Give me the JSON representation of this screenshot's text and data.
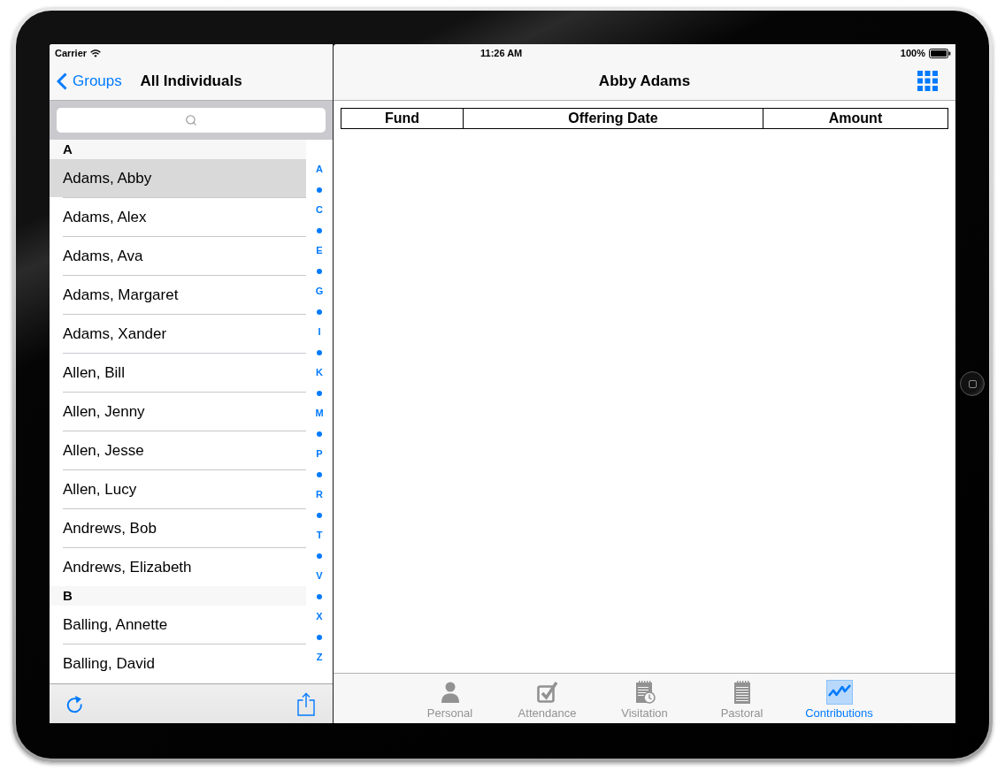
{
  "left_panel": {
    "status_bar": {
      "carrier": "Carrier"
    },
    "nav_bar": {
      "back": "Groups",
      "title": "All Individuals"
    },
    "sections": [
      {
        "header": "A",
        "rows": [
          {
            "name": "Adams, Abby",
            "selected": true
          },
          {
            "name": "Adams, Alex",
            "selected": false
          },
          {
            "name": "Adams, Ava",
            "selected": false
          },
          {
            "name": "Adams, Margaret",
            "selected": false
          },
          {
            "name": "Adams, Xander",
            "selected": false
          },
          {
            "name": "Allen, Bill",
            "selected": false
          },
          {
            "name": "Allen, Jenny",
            "selected": false
          },
          {
            "name": "Allen, Jesse",
            "selected": false
          },
          {
            "name": "Allen, Lucy",
            "selected": false
          },
          {
            "name": "Andrews, Bob",
            "selected": false
          },
          {
            "name": "Andrews, Elizabeth",
            "selected": false
          }
        ]
      },
      {
        "header": "B",
        "rows": [
          {
            "name": "Balling, Annette",
            "selected": false
          },
          {
            "name": "Balling, David",
            "selected": false
          }
        ]
      }
    ],
    "index": [
      {
        "kind": "letter",
        "label": "A"
      },
      {
        "kind": "dot"
      },
      {
        "kind": "letter",
        "label": "C"
      },
      {
        "kind": "dot"
      },
      {
        "kind": "letter",
        "label": "E"
      },
      {
        "kind": "dot"
      },
      {
        "kind": "letter",
        "label": "G"
      },
      {
        "kind": "dot"
      },
      {
        "kind": "letter",
        "label": "I"
      },
      {
        "kind": "dot"
      },
      {
        "kind": "letter",
        "label": "K"
      },
      {
        "kind": "dot"
      },
      {
        "kind": "letter",
        "label": "M"
      },
      {
        "kind": "dot"
      },
      {
        "kind": "letter",
        "label": "P"
      },
      {
        "kind": "dot"
      },
      {
        "kind": "letter",
        "label": "R"
      },
      {
        "kind": "dot"
      },
      {
        "kind": "letter",
        "label": "T"
      },
      {
        "kind": "dot"
      },
      {
        "kind": "letter",
        "label": "V"
      },
      {
        "kind": "dot"
      },
      {
        "kind": "letter",
        "label": "X"
      },
      {
        "kind": "dot"
      },
      {
        "kind": "letter",
        "label": "Z"
      }
    ]
  },
  "right_panel": {
    "status_bar": {
      "time": "11:26 AM",
      "battery": "100%"
    },
    "nav_bar": {
      "title": "Abby Adams"
    },
    "table": {
      "columns": [
        "Fund",
        "Offering Date",
        "Amount"
      ]
    },
    "tabs": [
      {
        "label": "Personal",
        "selected": false
      },
      {
        "label": "Attendance",
        "selected": false
      },
      {
        "label": "Visitation",
        "selected": false
      },
      {
        "label": "Pastoral",
        "selected": false
      },
      {
        "label": "Contributions",
        "selected": true
      }
    ]
  }
}
